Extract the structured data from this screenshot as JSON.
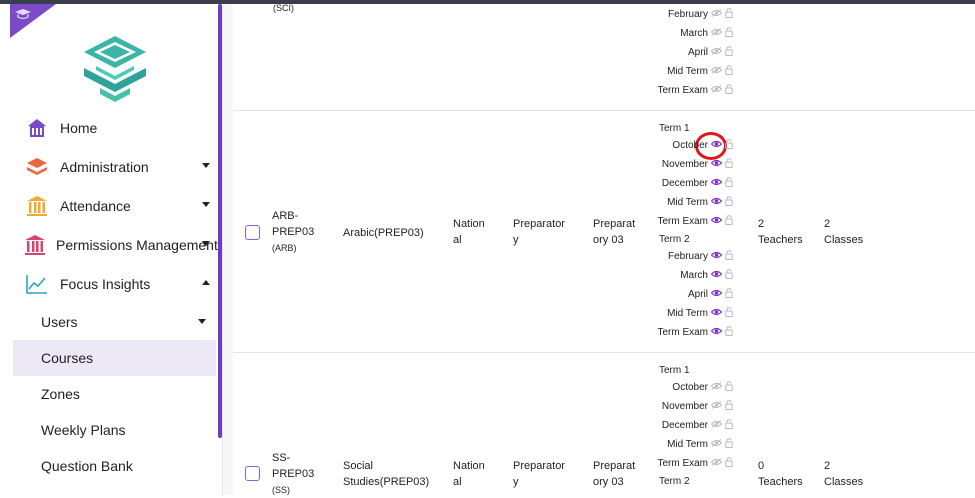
{
  "sidebar": {
    "nav": [
      {
        "label": "Home",
        "icon": "home-icon"
      },
      {
        "label": "Administration",
        "icon": "layers-icon"
      },
      {
        "label": "Attendance",
        "icon": "columns-icon"
      },
      {
        "label": "Permissions Management",
        "icon": "bank-icon"
      },
      {
        "label": "Focus Insights",
        "icon": "chart-line-icon"
      }
    ],
    "sub": [
      {
        "label": "Users"
      },
      {
        "label": "Courses"
      },
      {
        "label": "Zones"
      },
      {
        "label": "Weekly Plans"
      },
      {
        "label": "Question Bank"
      }
    ]
  },
  "top_row": {
    "code_tail": "(SCI)",
    "terms": [
      "February",
      "March",
      "April",
      "Mid Term",
      "Term Exam"
    ]
  },
  "arb_row": {
    "code1": "ARB-",
    "code2": "PREP03",
    "code3": "(ARB)",
    "name": "Arabic(PREP03)",
    "type1": "Nation",
    "type2": "al",
    "stage1": "Preparator",
    "stage2": "y",
    "grade1": "Preparat",
    "grade2": "ory 03",
    "term1_label": "Term 1",
    "term1": [
      "October",
      "November",
      "December",
      "Mid Term",
      "Term Exam"
    ],
    "term2_label": "Term 2",
    "term2": [
      "February",
      "March",
      "April",
      "Mid Term",
      "Term Exam"
    ],
    "teachers1": "2",
    "teachers2": "Teachers",
    "classes1": "2",
    "classes2": "Classes"
  },
  "ss_row": {
    "code1": "SS-",
    "code2": "PREP03",
    "code3": "(SS)",
    "name1": "Social",
    "name2": "Studies(PREP03)",
    "type1": "Nation",
    "type2": "al",
    "stage1": "Preparator",
    "stage2": "y",
    "grade1": "Preparat",
    "grade2": "ory 03",
    "term1_label": "Term 1",
    "term1": [
      "October",
      "November",
      "December",
      "Mid Term",
      "Term Exam"
    ],
    "term2_label": "Term 2",
    "teachers1": "0",
    "teachers2": "Teachers",
    "classes1": "2",
    "classes2": "Classes"
  },
  "colors": {
    "accent": "#7b4ac9",
    "highlight": "#e0161c"
  }
}
